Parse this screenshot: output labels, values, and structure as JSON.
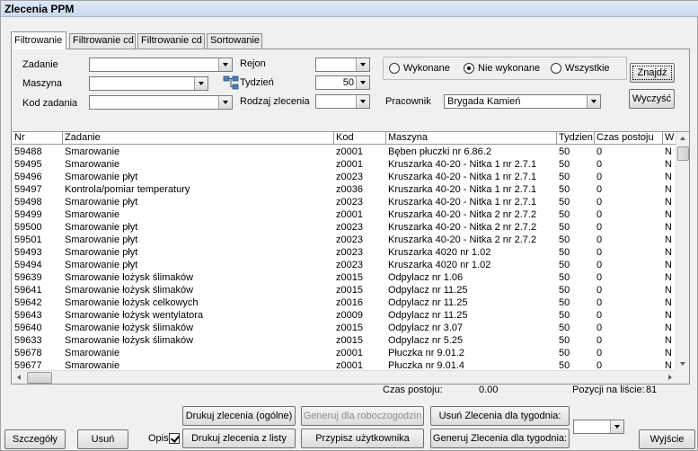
{
  "window": {
    "title": "Zlecenia PPM"
  },
  "tabs": [
    {
      "label": "Filtrowanie",
      "active": true
    },
    {
      "label": "Filtrowanie cd",
      "active": false
    },
    {
      "label": "Filtrowanie cd",
      "active": false
    },
    {
      "label": "Sortowanie",
      "active": false
    }
  ],
  "filters": {
    "zadanie_label": "Zadanie",
    "zadanie_value": "",
    "maszyna_label": "Maszyna",
    "maszyna_value": "",
    "kod_label": "Kod zadania",
    "kod_value": "",
    "rejon_label": "Rejon",
    "rejon_value": "",
    "tydzien_label": "Tydzień",
    "tydzien_value": "50",
    "rodzaj_label": "Rodzaj zlecenia",
    "rodzaj_value": "",
    "pracownik_label": "Pracownik",
    "pracownik_value": "Brygada Kamień",
    "status_options": [
      {
        "label": "Wykonane",
        "selected": false
      },
      {
        "label": "Nie wykonane",
        "selected": true
      },
      {
        "label": "Wszystkie",
        "selected": false
      }
    ],
    "find_label": "Znajdź",
    "clear_label": "Wyczyść"
  },
  "grid": {
    "columns": [
      "Nr",
      "Zadanie",
      "Kod",
      "Maszyna",
      "Tydzien",
      "Czas postoju",
      "W"
    ],
    "rows": [
      [
        "59488",
        "Smarowanie",
        "z0001",
        "Bęben płuczki nr 6.86.2",
        "50",
        "0",
        "N"
      ],
      [
        "59495",
        "Smarowanie",
        "z0001",
        "Kruszarka 40-20 - Nitka 1 nr 2.7.1",
        "50",
        "0",
        "N"
      ],
      [
        "59496",
        "Smarowanie płyt",
        "z0023",
        "Kruszarka 40-20 - Nitka 1 nr 2.7.1",
        "50",
        "0",
        "N"
      ],
      [
        "59497",
        "Kontrola/pomiar temperatury",
        "z0036",
        "Kruszarka 40-20 - Nitka 1 nr 2.7.1",
        "50",
        "0",
        "N"
      ],
      [
        "59498",
        "Smarowanie płyt",
        "z0023",
        "Kruszarka 40-20 - Nitka 1 nr 2.7.1",
        "50",
        "0",
        "N"
      ],
      [
        "59499",
        "Smarowanie",
        "z0001",
        "Kruszarka 40-20 - Nitka 2 nr 2.7.2",
        "50",
        "0",
        "N"
      ],
      [
        "59500",
        "Smarowanie płyt",
        "z0023",
        "Kruszarka 40-20 - Nitka 2 nr 2.7.2",
        "50",
        "0",
        "N"
      ],
      [
        "59501",
        "Smarowanie płyt",
        "z0023",
        "Kruszarka 40-20 - Nitka 2 nr 2.7.2",
        "50",
        "0",
        "N"
      ],
      [
        "59493",
        "Smarowanie płyt",
        "z0023",
        "Kruszarka 4020 nr 1.02",
        "50",
        "0",
        "N"
      ],
      [
        "59494",
        "Smarowanie płyt",
        "z0023",
        "Kruszarka 4020 nr 1.02",
        "50",
        "0",
        "N"
      ],
      [
        "59639",
        "Smarowanie łożysk ślimaków",
        "z0015",
        "Odpylacz nr 1.06",
        "50",
        "0",
        "N"
      ],
      [
        "59641",
        "Smarowanie łożysk ślimaków",
        "z0015",
        "Odpylacz nr 11.25",
        "50",
        "0",
        "N"
      ],
      [
        "59642",
        "Smarowanie łożysk celkowych",
        "z0016",
        "Odpylacz nr 11.25",
        "50",
        "0",
        "N"
      ],
      [
        "59643",
        "Smarowanie łożysk wentylatora",
        "z0009",
        "Odpylacz nr 11.25",
        "50",
        "0",
        "N"
      ],
      [
        "59640",
        "Smarowanie łożysk ślimaków",
        "z0015",
        "Odpylacz nr 3.07",
        "50",
        "0",
        "N"
      ],
      [
        "59633",
        "Smarowanie łożysk ślimaków",
        "z0015",
        "Odpylacz nr 5.25",
        "50",
        "0",
        "N"
      ],
      [
        "59678",
        "Smarowanie",
        "z0001",
        "Płuczka nr 9.01.2",
        "50",
        "0",
        "N"
      ],
      [
        "59677",
        "Smarowanie",
        "z0001",
        "Płuczka nr 9.01.4",
        "50",
        "0",
        "N"
      ]
    ]
  },
  "summary": {
    "czas_label": "Czas postoju:",
    "czas_value": "0.00",
    "pozycji_label": "Pozycji na liście:",
    "pozycji_value": "81"
  },
  "footer": {
    "szczegoly": "Szczegóły",
    "usun": "Usuń",
    "opis_label": "Opis",
    "opis_checked": true,
    "drukuj_ogolne": "Drukuj zlecenia (ogólne)",
    "drukuj_listy": "Drukuj zlecenia z listy",
    "generuj_robocz": "Generuj dla roboczogodzin",
    "przypisz": "Przypisz użytkownika",
    "usun_tydzien": "Usuń Zlecenia dla tygodnia:",
    "generuj_tydzien": "Generuj Zlecenia dla tygodnia:",
    "tydzien_value": "",
    "wyjscie": "Wyjście"
  }
}
